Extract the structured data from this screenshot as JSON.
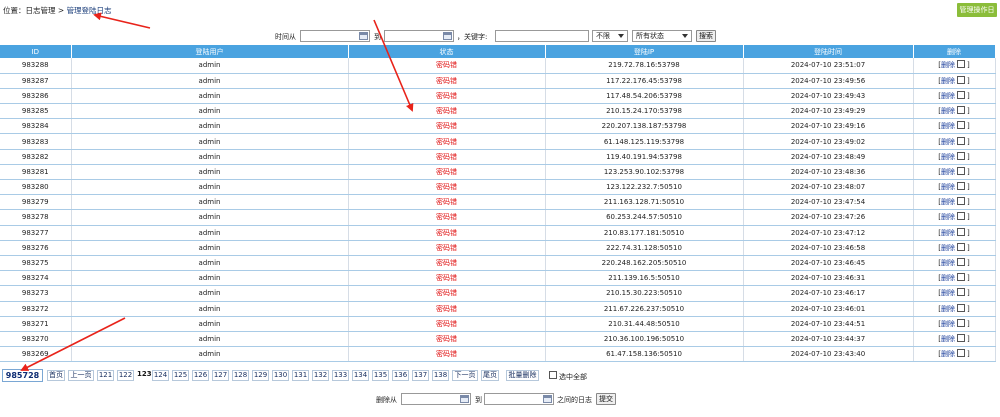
{
  "breadcrumb": {
    "prefix": "位置：",
    "section": "日志管理",
    "separator": " > ",
    "current": "管理登陆日志"
  },
  "op_log_button": "管理操作日志",
  "filter": {
    "time_from_label": "时间从",
    "to_label": "到",
    "keyword_label": "，关键字:",
    "select1": "不限",
    "select2": "所有状态",
    "search_button": "搜索"
  },
  "table": {
    "headers": [
      "ID",
      "登陆用户",
      "状态",
      "登陆IP",
      "登陆时间",
      "删除"
    ],
    "delete_link": "删除",
    "rows": [
      {
        "id": "983288",
        "user": "admin",
        "status": "密码错",
        "ip": "219.72.78.16:53798",
        "time": "2024-07-10 23:51:07"
      },
      {
        "id": "983287",
        "user": "admin",
        "status": "密码错",
        "ip": "117.22.176.45:53798",
        "time": "2024-07-10 23:49:56"
      },
      {
        "id": "983286",
        "user": "admin",
        "status": "密码错",
        "ip": "117.48.54.206:53798",
        "time": "2024-07-10 23:49:43"
      },
      {
        "id": "983285",
        "user": "admin",
        "status": "密码错",
        "ip": "210.15.24.170:53798",
        "time": "2024-07-10 23:49:29"
      },
      {
        "id": "983284",
        "user": "admin",
        "status": "密码错",
        "ip": "220.207.138.187:53798",
        "time": "2024-07-10 23:49:16"
      },
      {
        "id": "983283",
        "user": "admin",
        "status": "密码错",
        "ip": "61.148.125.119:53798",
        "time": "2024-07-10 23:49:02"
      },
      {
        "id": "983282",
        "user": "admin",
        "status": "密码错",
        "ip": "119.40.191.94:53798",
        "time": "2024-07-10 23:48:49"
      },
      {
        "id": "983281",
        "user": "admin",
        "status": "密码错",
        "ip": "123.253.90.102:53798",
        "time": "2024-07-10 23:48:36"
      },
      {
        "id": "983280",
        "user": "admin",
        "status": "密码错",
        "ip": "123.122.232.7:50510",
        "time": "2024-07-10 23:48:07"
      },
      {
        "id": "983279",
        "user": "admin",
        "status": "密码错",
        "ip": "211.163.128.71:50510",
        "time": "2024-07-10 23:47:54"
      },
      {
        "id": "983278",
        "user": "admin",
        "status": "密码错",
        "ip": "60.253.244.57:50510",
        "time": "2024-07-10 23:47:26"
      },
      {
        "id": "983277",
        "user": "admin",
        "status": "密码错",
        "ip": "210.83.177.181:50510",
        "time": "2024-07-10 23:47:12"
      },
      {
        "id": "983276",
        "user": "admin",
        "status": "密码错",
        "ip": "222.74.31.128:50510",
        "time": "2024-07-10 23:46:58"
      },
      {
        "id": "983275",
        "user": "admin",
        "status": "密码错",
        "ip": "220.248.162.205:50510",
        "time": "2024-07-10 23:46:45"
      },
      {
        "id": "983274",
        "user": "admin",
        "status": "密码错",
        "ip": "211.139.16.5:50510",
        "time": "2024-07-10 23:46:31"
      },
      {
        "id": "983273",
        "user": "admin",
        "status": "密码错",
        "ip": "210.15.30.223:50510",
        "time": "2024-07-10 23:46:17"
      },
      {
        "id": "983272",
        "user": "admin",
        "status": "密码错",
        "ip": "211.67.226.237:50510",
        "time": "2024-07-10 23:46:01"
      },
      {
        "id": "983271",
        "user": "admin",
        "status": "密码错",
        "ip": "210.31.44.48:50510",
        "time": "2024-07-10 23:44:51"
      },
      {
        "id": "983270",
        "user": "admin",
        "status": "密码错",
        "ip": "210.36.100.196:50510",
        "time": "2024-07-10 23:44:37"
      },
      {
        "id": "983269",
        "user": "admin",
        "status": "密码错",
        "ip": "61.47.158.136:50510",
        "time": "2024-07-10 23:43:40"
      }
    ]
  },
  "pager": {
    "total": "985728",
    "first": "首页",
    "prev": "上一页",
    "pages": [
      "121",
      "122",
      "123",
      "124",
      "125",
      "126",
      "127",
      "128",
      "129",
      "130",
      "131",
      "132",
      "133",
      "134",
      "135",
      "136",
      "137",
      "138"
    ],
    "current_page": "123",
    "next": "下一页",
    "last": "尾页",
    "batch_delete": "批量删除",
    "select_all": "选中全部"
  },
  "bottom": {
    "delete_from_label": "删除从",
    "to_label": "到",
    "between_label": "之间的日志",
    "submit": "提交"
  },
  "colors": {
    "header_bg": "#4aa3e0",
    "status_red": "#e01010",
    "op_button_green": "#8bbd3a",
    "annotation_arrow": "#e8231a"
  }
}
